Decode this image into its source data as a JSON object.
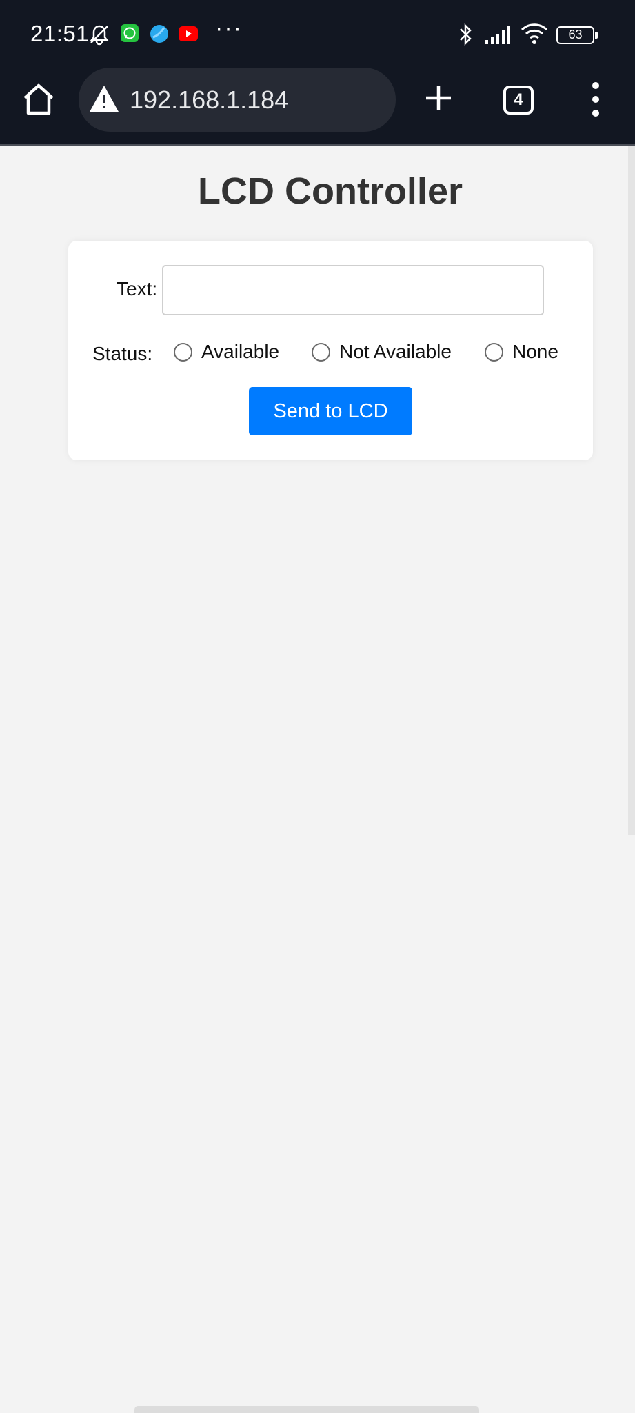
{
  "status_bar": {
    "time": "21:51",
    "notification_icons": [
      "bell-off-icon",
      "whatsapp-icon",
      "browser-icon",
      "youtube-icon"
    ],
    "more": "···",
    "system_icons": [
      "bluetooth-icon",
      "signal-icon",
      "wifi-icon"
    ],
    "battery": "63"
  },
  "browser": {
    "url": "192.168.1.184",
    "security_icon": "warning-icon",
    "tab_count": "4"
  },
  "page": {
    "title": "LCD Controller",
    "form": {
      "text_label": "Text:",
      "text_value": "",
      "status_label": "Status:",
      "status_options": [
        "Available",
        "Not Available",
        "None"
      ],
      "selected_status": null,
      "submit_label": "Send to LCD"
    }
  },
  "colors": {
    "toolbar_bg": "#121722",
    "page_bg": "#f3f3f3",
    "button_blue": "#007bff",
    "title_color": "#333333"
  }
}
